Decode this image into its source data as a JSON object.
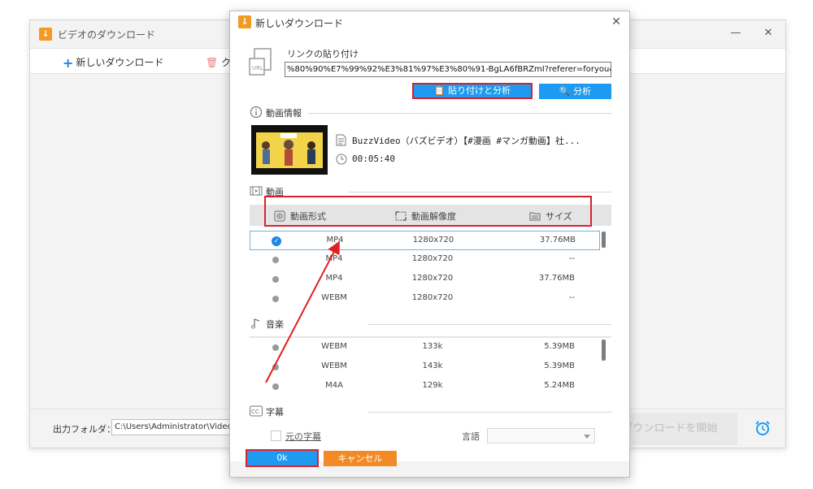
{
  "main_window": {
    "title": "ビデオのダウンロード",
    "minimize": "—",
    "close": "✕",
    "toolbar": {
      "new_download_label": "新しいダウンロード",
      "clear_label": "ク"
    },
    "output_folder_label": "出力フォルダ：",
    "output_folder_path": "C:\\Users\\Administrator\\Videos\\Wonde",
    "start_download_label": "ダウンロードを開始"
  },
  "dialog": {
    "title": "新しいダウンロード",
    "close": "✕",
    "link_label": "リンクの貼り付け",
    "url_value": "%80%90%E7%99%92%E3%81%97%E3%80%91-BgLA6fBRZmI?referer=foryou&pid=website_feed",
    "paste_analyze_label": "貼り付けと分析",
    "analyze_label": "分析",
    "video_info": {
      "header": "動画情報",
      "title": "BuzzVideo（バズビデオ）【#漫画 #マンガ動画】社...",
      "duration": "00:05:40"
    },
    "video": {
      "header": "動画",
      "columns": [
        "動画形式",
        "動画解像度",
        "サイズ"
      ],
      "rows": [
        {
          "format": "MP4",
          "resolution": "1280x720",
          "size": "37.76MB",
          "selected": true
        },
        {
          "format": "MP4",
          "resolution": "1280x720",
          "size": "--",
          "selected": false
        },
        {
          "format": "MP4",
          "resolution": "1280x720",
          "size": "37.76MB",
          "selected": false
        },
        {
          "format": "WEBM",
          "resolution": "1280x720",
          "size": "--",
          "selected": false
        }
      ]
    },
    "audio": {
      "header": "音楽",
      "rows": [
        {
          "format": "WEBM",
          "bitrate": "133k",
          "size": "5.39MB"
        },
        {
          "format": "WEBM",
          "bitrate": "143k",
          "size": "5.39MB"
        },
        {
          "format": "M4A",
          "bitrate": "129k",
          "size": "5.24MB"
        }
      ]
    },
    "subtitle": {
      "header": "字幕",
      "original_subtitle_label": "元の字幕",
      "language_label": "言語",
      "language_value": ""
    },
    "ok_label": "0k",
    "cancel_label": "キャンセル"
  },
  "colors": {
    "accent_blue": "#1e9bf0",
    "highlight_red": "#d9212e",
    "cancel_orange": "#f28a25",
    "brand_orange": "#f39a22"
  }
}
